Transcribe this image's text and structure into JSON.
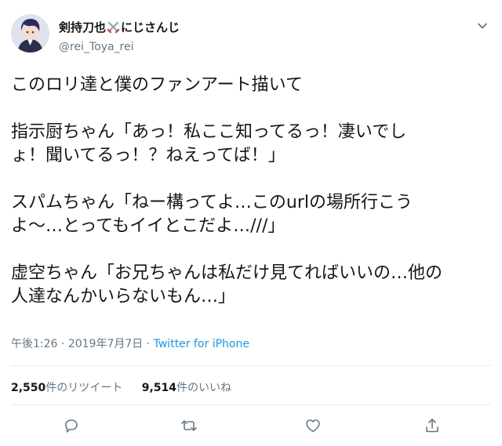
{
  "user": {
    "display_name_pre": "剣持刀也",
    "display_name_post": "にじさんじ",
    "emoji_icon": "crossed-swords-icon",
    "handle": "@rei_Toya_rei"
  },
  "tweet": {
    "lines": [
      "このロリ達と僕のファンアート描いて",
      "",
      "指示厨ちゃん「あっ！私ここ知ってるっ！凄いでし",
      "ょ！聞いてるっ！？ねえってば！」",
      "",
      "スパムちゃん「ねー構ってよ…このurlの場所行こう",
      "よ〜…とってもイイとこだよ…///」",
      "",
      "虚空ちゃん「お兄ちゃんは私だけ見てればいいの…他の",
      "人達なんかいらないもん…」"
    ]
  },
  "meta": {
    "time": "午後1:26",
    "separator": "·",
    "date": "2019年7月7日",
    "source": "Twitter for iPhone"
  },
  "stats": {
    "retweets_count": "2,550",
    "retweets_label": "件のリツイート",
    "likes_count": "9,514",
    "likes_label": "件のいいね"
  },
  "actions": [
    "reply-icon",
    "retweet-icon",
    "like-icon",
    "share-icon"
  ],
  "colors": {
    "text": "#14171a",
    "secondary": "#657786",
    "link": "#1b95e0",
    "divider": "#e6ecf0"
  }
}
